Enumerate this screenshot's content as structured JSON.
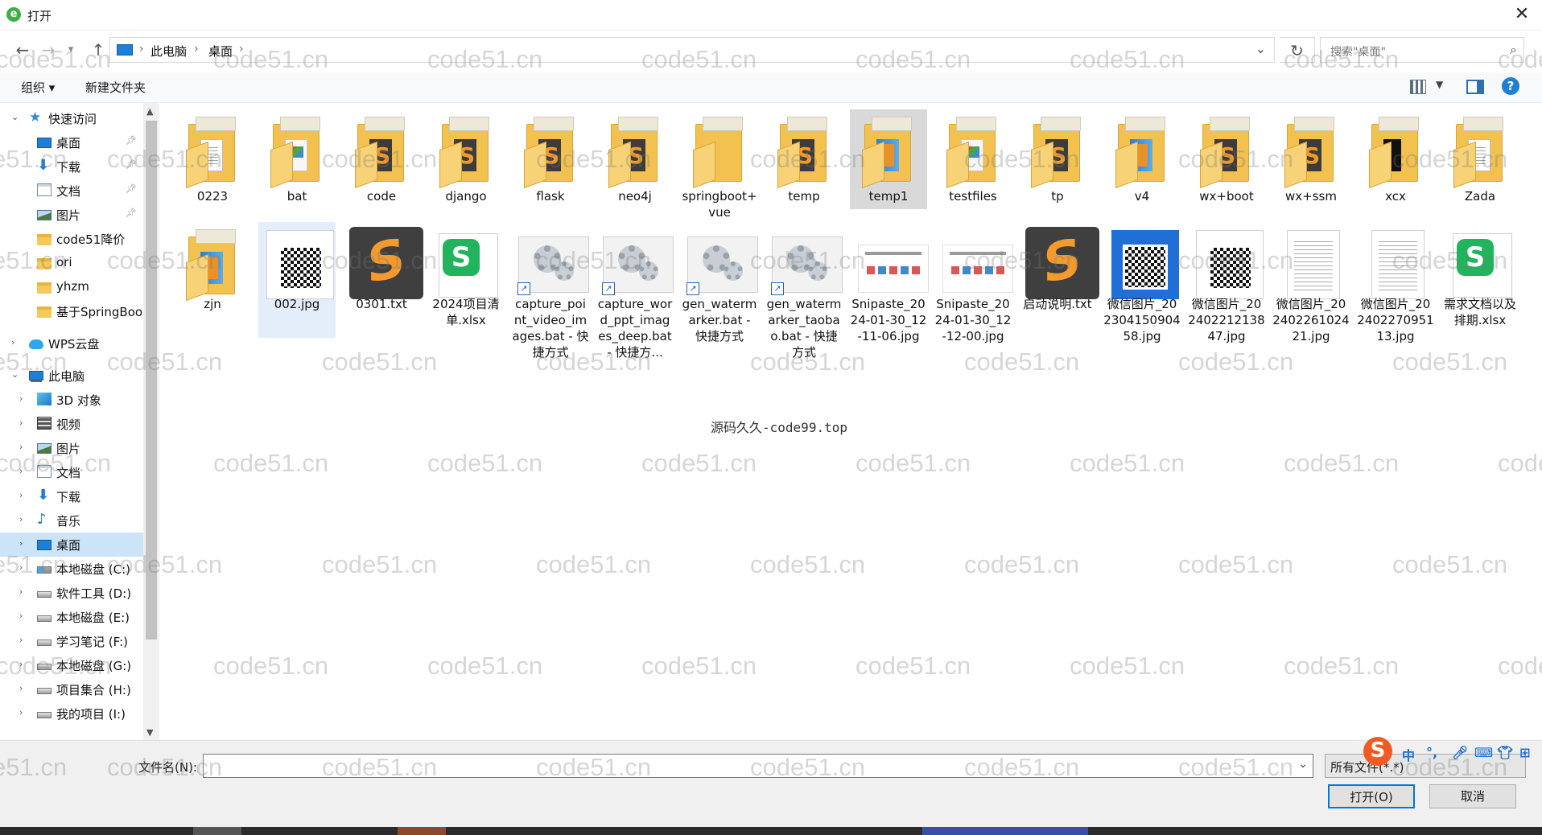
{
  "window": {
    "title": "打开",
    "close_icon": "close-icon"
  },
  "address": {
    "crumbs": [
      "此电脑",
      "桌面"
    ],
    "search_placeholder": "搜索\"桌面\""
  },
  "toolbar": {
    "organize": "组织 ▾",
    "new_folder": "新建文件夹"
  },
  "sidebar": {
    "items": [
      {
        "label": "快速访问",
        "icon": "star-icon"
      },
      {
        "label": "桌面",
        "icon": "desktop-icon"
      },
      {
        "label": "下载",
        "icon": "download-icon"
      },
      {
        "label": "文档",
        "icon": "document-icon"
      },
      {
        "label": "图片",
        "icon": "picture-icon"
      },
      {
        "label": "code51降价",
        "icon": "folder-icon"
      },
      {
        "label": "ori",
        "icon": "folder-icon"
      },
      {
        "label": "yhzm",
        "icon": "folder-icon"
      },
      {
        "label": "基于SpringBoo",
        "icon": "folder-icon"
      },
      {
        "label": "WPS云盘",
        "icon": "cloud-icon"
      },
      {
        "label": "此电脑",
        "icon": "pc-icon"
      },
      {
        "label": "3D 对象",
        "icon": "3d-icon"
      },
      {
        "label": "视频",
        "icon": "video-icon"
      },
      {
        "label": "图片",
        "icon": "picture-icon"
      },
      {
        "label": "文档",
        "icon": "document-icon"
      },
      {
        "label": "下载",
        "icon": "download-icon"
      },
      {
        "label": "音乐",
        "icon": "music-icon"
      },
      {
        "label": "桌面",
        "icon": "desktop-icon"
      },
      {
        "label": "本地磁盘 (C:)",
        "icon": "drive-icon"
      },
      {
        "label": "软件工具 (D:)",
        "icon": "drive-icon"
      },
      {
        "label": "本地磁盘 (E:)",
        "icon": "drive-icon"
      },
      {
        "label": "学习笔记 (F:)",
        "icon": "drive-icon"
      },
      {
        "label": "本地磁盘 (G:)",
        "icon": "drive-icon"
      },
      {
        "label": "项目集合 (H:)",
        "icon": "drive-icon"
      },
      {
        "label": "我的项目 (I:)",
        "icon": "drive-icon"
      }
    ]
  },
  "files": [
    {
      "name": "0223",
      "type": "folder"
    },
    {
      "name": "bat",
      "type": "folder"
    },
    {
      "name": "code",
      "type": "folder"
    },
    {
      "name": "django",
      "type": "folder"
    },
    {
      "name": "flask",
      "type": "folder"
    },
    {
      "name": "neo4j",
      "type": "folder"
    },
    {
      "name": "springboot+vue",
      "type": "folder"
    },
    {
      "name": "temp",
      "type": "folder"
    },
    {
      "name": "temp1",
      "type": "folder"
    },
    {
      "name": "testfiles",
      "type": "folder"
    },
    {
      "name": "tp",
      "type": "folder"
    },
    {
      "name": "v4",
      "type": "folder"
    },
    {
      "name": "wx+boot",
      "type": "folder"
    },
    {
      "name": "wx+ssm",
      "type": "folder"
    },
    {
      "name": "xcx",
      "type": "folder"
    },
    {
      "name": "Zada",
      "type": "folder"
    },
    {
      "name": "zjn",
      "type": "folder"
    },
    {
      "name": "002.jpg",
      "type": "image-qr"
    },
    {
      "name": "0301.txt",
      "type": "sublime-file"
    },
    {
      "name": "2024项目清单.xlsx",
      "type": "spreadsheet"
    },
    {
      "name": "capture_point_video_images.bat - 快捷方式",
      "type": "shortcut"
    },
    {
      "name": "capture_word_ppt_images_deep.bat - 快捷方...",
      "type": "shortcut"
    },
    {
      "name": "gen_watermarker.bat - 快捷方式",
      "type": "shortcut"
    },
    {
      "name": "gen_watermarker_taobao.bat - 快捷方式",
      "type": "shortcut"
    },
    {
      "name": "Snipaste_2024-01-30_12-11-06.jpg",
      "type": "screenshot"
    },
    {
      "name": "Snipaste_2024-01-30_12-12-00.jpg",
      "type": "screenshot"
    },
    {
      "name": "启动说明.txt",
      "type": "sublime-file"
    },
    {
      "name": "微信图片_20230415090458.jpg",
      "type": "image-qr-blue"
    },
    {
      "name": "微信图片_20240221213847.jpg",
      "type": "image-qr"
    },
    {
      "name": "微信图片_20240226102421.jpg",
      "type": "doc-image"
    },
    {
      "name": "微信图片_20240227095113.jpg",
      "type": "doc-image"
    },
    {
      "name": "需求文档以及排期.xlsx",
      "type": "spreadsheet"
    }
  ],
  "center_note": "源码久久-code99.top",
  "watermark": "code51.cn",
  "bottom": {
    "filename_label": "文件名(N):",
    "filename_value": "",
    "filetype": "所有文件(*.*)",
    "open_button": "打开(O)",
    "cancel_button": "取消"
  },
  "ime": {
    "mode": "中",
    "punct": "°,",
    "logo": "S"
  }
}
